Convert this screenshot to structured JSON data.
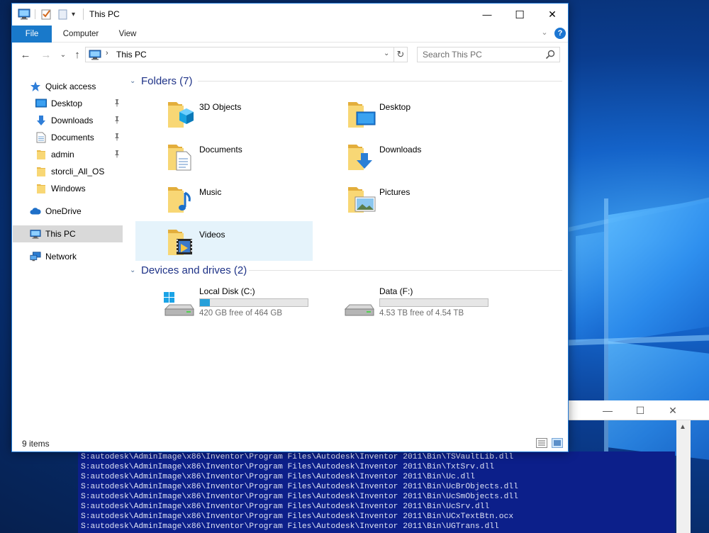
{
  "window": {
    "title": "This PC",
    "controls": {
      "minimize": "—",
      "maximize": "☐",
      "close": "✕"
    }
  },
  "ribbon": {
    "tabs": [
      "File",
      "Computer",
      "View"
    ],
    "expand_glyph": "⌄",
    "help_glyph": "?"
  },
  "navigation": {
    "back": "←",
    "forward": "→",
    "recent": "⌄",
    "up": "↑",
    "address": "This PC",
    "address_chevron": "›",
    "address_dropdown": "⌄",
    "refresh": "↻",
    "search_placeholder": "Search This PC"
  },
  "sidebar": {
    "quick_access": "Quick access",
    "quick_items": [
      {
        "label": "Desktop",
        "icon": "desktop-icon",
        "pinned": true
      },
      {
        "label": "Downloads",
        "icon": "downloads-icon",
        "pinned": true
      },
      {
        "label": "Documents",
        "icon": "documents-icon",
        "pinned": true
      },
      {
        "label": "admin",
        "icon": "folder-icon",
        "pinned": true
      },
      {
        "label": "storcli_All_OS",
        "icon": "folder-icon",
        "pinned": false
      },
      {
        "label": "Windows",
        "icon": "folder-icon",
        "pinned": false
      }
    ],
    "onedrive": "OneDrive",
    "this_pc": "This PC",
    "network": "Network"
  },
  "content": {
    "folders_header": "Folders (7)",
    "folders": [
      {
        "label": "3D Objects",
        "icon": "3d-objects-icon"
      },
      {
        "label": "Desktop",
        "icon": "desktop-folder-icon"
      },
      {
        "label": "Documents",
        "icon": "documents-folder-icon"
      },
      {
        "label": "Downloads",
        "icon": "downloads-folder-icon"
      },
      {
        "label": "Music",
        "icon": "music-folder-icon"
      },
      {
        "label": "Pictures",
        "icon": "pictures-folder-icon"
      },
      {
        "label": "Videos",
        "icon": "videos-folder-icon"
      }
    ],
    "devices_header": "Devices and drives (2)",
    "drives": [
      {
        "label": "Local Disk (C:)",
        "free_text": "420 GB free of 464 GB",
        "used_fraction": 0.095,
        "icon": "windows-drive-icon"
      },
      {
        "label": "Data (F:)",
        "free_text": "4.53 TB free of 4.54 TB",
        "used_fraction": 0.002,
        "icon": "drive-icon"
      }
    ]
  },
  "statusbar": {
    "item_count": "9 items"
  },
  "console": {
    "lines": [
      "S:autodesk\\AdminImage\\x86\\Inventor\\Program Files\\Autodesk\\Inventor 2011\\Bin\\TSVaultLib.dll",
      "S:autodesk\\AdminImage\\x86\\Inventor\\Program Files\\Autodesk\\Inventor 2011\\Bin\\TxtSrv.dll",
      "S:autodesk\\AdminImage\\x86\\Inventor\\Program Files\\Autodesk\\Inventor 2011\\Bin\\Uc.dll",
      "S:autodesk\\AdminImage\\x86\\Inventor\\Program Files\\Autodesk\\Inventor 2011\\Bin\\UcBrObjects.dll",
      "S:autodesk\\AdminImage\\x86\\Inventor\\Program Files\\Autodesk\\Inventor 2011\\Bin\\UcSmObjects.dll",
      "S:autodesk\\AdminImage\\x86\\Inventor\\Program Files\\Autodesk\\Inventor 2011\\Bin\\UcSrv.dll",
      "S:autodesk\\AdminImage\\x86\\Inventor\\Program Files\\Autodesk\\Inventor 2011\\Bin\\UCxTextBtn.ocx",
      "S:autodesk\\AdminImage\\x86\\Inventor\\Program Files\\Autodesk\\Inventor 2011\\Bin\\UGTrans.dll"
    ],
    "controls": {
      "minimize": "—",
      "maximize": "☐",
      "close": "✕"
    },
    "scroll_up": "▲"
  },
  "colors": {
    "accent": "#1979ca",
    "group_title": "#1e3287",
    "drive_fill": "#26a0da",
    "console_bg": "#0c1f8a",
    "selection": "#d9d9d9",
    "hover": "#e5f3fb"
  }
}
